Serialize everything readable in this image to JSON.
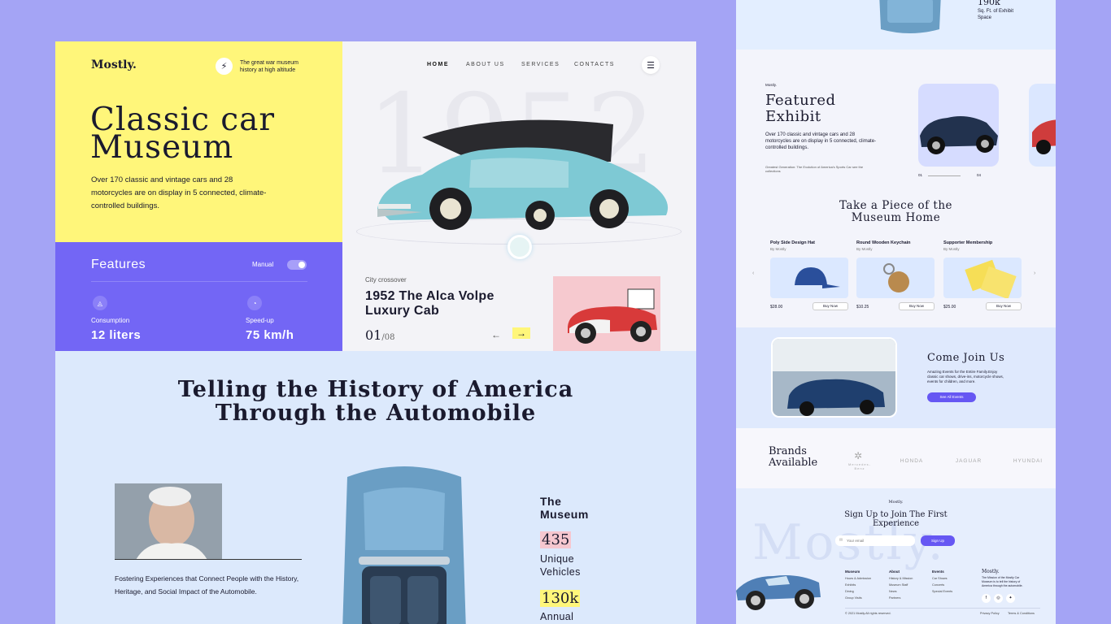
{
  "hero": {
    "logo": "Mostly.",
    "tagline": "The great war museum history at high altitude",
    "title_line1": "Classic car",
    "title_line2": "Museum",
    "description": "Over 170 classic and vintage cars and 28 motorcycles are on display in 5 connected, climate-controlled buildings."
  },
  "nav": {
    "items": [
      "HOME",
      "ABOUT US",
      "SERVICES",
      "CONTACTS"
    ]
  },
  "features": {
    "title": "Features",
    "toggle_label": "Manual",
    "consumption_label": "Consumption",
    "consumption_value": "12 liters",
    "speed_label": "Speed-up",
    "speed_value": "75 km/h"
  },
  "showcase": {
    "year": "1952",
    "category": "City crossover",
    "car_name": "1952 The Alca Volpe Luxury Cab",
    "counter_current": "01",
    "counter_total": "/08"
  },
  "history": {
    "title_line1": "Telling the History of America",
    "title_line2": "Through the Automobile",
    "description": "Fostering Experiences that Connect People with the History, Heritage, and Social Impact of the Automobile.",
    "museum_heading": "The Museum",
    "stat1_value": "435",
    "stat1_label": "Unique Vehicles",
    "stat2_value": "130k",
    "stat2_label": "Annual"
  },
  "right": {
    "top_stat_value": "190k",
    "top_stat_label": "Sq. Ft. of Exhibit Space",
    "fe_brand": "Mostly.",
    "fe_title_1": "Featured",
    "fe_title_2": "Exhibit",
    "fe_desc": "Over 170 classic and vintage cars and 28 motorcycles are on display in 5 connected, climate-controlled buildings.",
    "fe_sub": "Greatest Generation: The Evolution of America's Sports Car see the collections",
    "fe_page_from": "01",
    "fe_page_to": "04",
    "take_1": "Take a Piece of the",
    "take_2": "Museum Home",
    "products": [
      {
        "name": "Poly Side Design Hat",
        "by": "By Mostly",
        "price": "$28.00",
        "buy": "Buy Now"
      },
      {
        "name": "Round Wooden Keychain",
        "by": "By Mostly",
        "price": "$10.25",
        "buy": "Buy Now"
      },
      {
        "name": "Supporter Membership",
        "by": "By Mostly",
        "price": "$25.00",
        "buy": "Buy Now"
      }
    ],
    "join_title": "Come Join Us",
    "join_desc": "Amazing Events for the Entire Family.Enjoy classic car shows, drive-ins, motorcycle shows, events for children, and more.",
    "join_button": "See All Events",
    "brands_1": "Brands",
    "brands_2": "Available",
    "brands": [
      "Mercedes-Benz",
      "HONDA",
      "JAGUAR",
      "HYUNDAI"
    ],
    "signup_brand": "Mostly.",
    "signup_title_1": "Sign Up to Join The First",
    "signup_title_2": "Experience",
    "email_placeholder": "Your email",
    "signup_button": "Sign Up",
    "watermark": "Mostly.",
    "footer_cols": [
      {
        "head": "Museum",
        "items": [
          "Hours & Admission",
          "Exhibits",
          "Dining",
          "Group Visits"
        ]
      },
      {
        "head": "About",
        "items": [
          "History & Mission",
          "Museum Staff",
          "News",
          "Partners"
        ]
      },
      {
        "head": "Events",
        "items": [
          "Car Shows",
          "Concerts",
          "Special Events"
        ]
      }
    ],
    "footer_brand": "Mostly.",
    "footer_brand_desc": "The Mission of the Mostly Car Museum is to tell the history of America through the automobile.",
    "copyright": "© 2021 Mostly.All rights reserved.",
    "privacy": "Privacy Policy",
    "terms": "Terms & Conditions"
  }
}
